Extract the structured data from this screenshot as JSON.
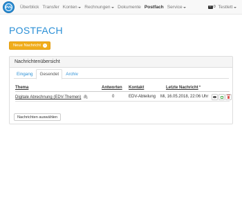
{
  "navbar": {
    "logo_text": "PVS",
    "items": [
      {
        "label": "Überblick",
        "dropdown": false,
        "active": false
      },
      {
        "label": "Transfer",
        "dropdown": false,
        "active": false
      },
      {
        "label": "Konten",
        "dropdown": true,
        "active": false
      },
      {
        "label": "Rechnungen",
        "dropdown": true,
        "active": false
      },
      {
        "label": "Dokumente",
        "dropdown": false,
        "active": false
      },
      {
        "label": "Postfach",
        "dropdown": false,
        "active": true
      },
      {
        "label": "Service",
        "dropdown": true,
        "active": false
      }
    ],
    "message_count": "0",
    "user_label": "Testlett"
  },
  "page": {
    "title": "POSTFACH",
    "new_message_button": "Neue Nachricht"
  },
  "panel": {
    "heading": "Nachrichtenübersicht",
    "tabs": [
      {
        "label": "Eingang",
        "active": false
      },
      {
        "label": "Gesendet",
        "active": true
      },
      {
        "label": "Archiv",
        "active": false
      }
    ],
    "table": {
      "headers": {
        "topic": "Thema",
        "replies": "Antworten",
        "contact": "Kontakt",
        "last_message": "Letzte Nachricht"
      },
      "rows": [
        {
          "topic": "Digitale Abrechnung (EDV-Themen)",
          "has_attachment": true,
          "replies": "0",
          "contact": "EDV-Abteilung",
          "last_message": "Mi, 16.05.2018, 22:06 Uhr"
        }
      ]
    },
    "select_button": "Nachrichten auswählen"
  },
  "colors": {
    "accent": "#2a8fd6",
    "warning": "#f0ad1c",
    "danger": "#d9534f",
    "success": "#4caf50"
  },
  "icons": {
    "logo": "pvs-logo-icon",
    "messages": "envelope-icon",
    "new_message": "chevron-right-circle-icon",
    "attachment": "paperclip-icon",
    "view": "eye-icon",
    "archive": "checkbox-icon",
    "delete": "trash-icon"
  }
}
